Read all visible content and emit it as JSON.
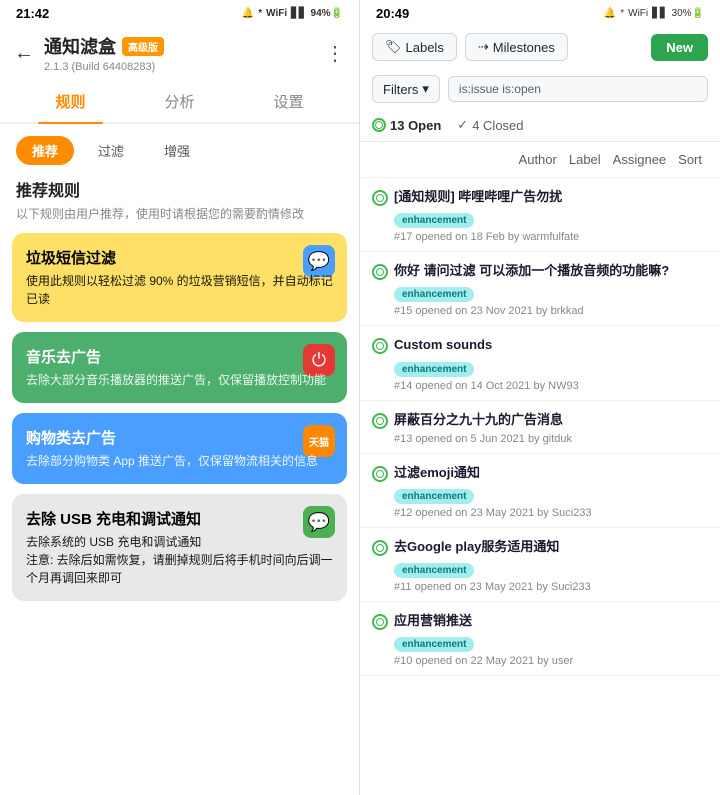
{
  "left": {
    "status_time": "21:42",
    "status_icons": "🔕 * ⑂ 📶 📶 94%",
    "back_label": "←",
    "title": "通知滤盒",
    "badge_pro": "高级版",
    "version": "2.1.3 (Build 64408283)",
    "menu_icon": "⋮",
    "tabs": [
      {
        "label": "规则",
        "active": true
      },
      {
        "label": "分析",
        "active": false
      },
      {
        "label": "设置",
        "active": false
      }
    ],
    "sub_tabs": [
      {
        "label": "推荐",
        "active": true
      },
      {
        "label": "过滤",
        "active": false
      },
      {
        "label": "增强",
        "active": false
      }
    ],
    "section_title": "推荐规则",
    "section_desc": "以下规则由用户推荐，使用时请根据您的需要酌情修改",
    "cards": [
      {
        "title": "垃圾短信过滤",
        "desc": "使用此规则以轻松过滤 90% 的垃圾营销短信，并自动标记已读",
        "color": "yellow",
        "icon": "💬",
        "icon_style": "blue-icon"
      },
      {
        "title": "音乐去广告",
        "desc": "去除大部分音乐播放器的推送广告，仅保留播放控制功能",
        "color": "green",
        "icon": "⏻",
        "icon_style": "red-icon"
      },
      {
        "title": "购物类去广告",
        "desc": "去除部分购物类 App 推送广告，仅保留物流相关的信息",
        "color": "blue",
        "icon": "天猫",
        "icon_style": "orange-icon"
      },
      {
        "title": "去除 USB 充电和调试通知",
        "desc": "去除系统的 USB 充电和调试通知\n注意: 去除后如需恢复，请删掉规则后将手机时间向后调一个月再调回来即可",
        "color": "gray",
        "icon": "💬",
        "icon_style": "green-msg"
      }
    ]
  },
  "right": {
    "status_time": "20:49",
    "status_icons": "🔕 * ⑂ 📶 📶 30%",
    "buttons": {
      "labels_label": "Labels",
      "milestones_label": "Milestones",
      "new_label": "New"
    },
    "filter": {
      "filter_label": "Filters",
      "filter_chevron": "▾",
      "search_value": "is:issue is:open"
    },
    "open_count": "13 Open",
    "closed_count": "4 Closed",
    "check_icon": "✓",
    "cols": {
      "author": "Author",
      "label": "Label",
      "assignee": "Assignee",
      "sort": "Sort"
    },
    "issues": [
      {
        "title": "[通知规则] 哔哩哔哩广告勿扰",
        "badge": "enhancement",
        "meta": "#17 opened on 18 Feb by warmfulfate"
      },
      {
        "title": "你好 请问过滤 可以添加一个播放音频的功能嘛?",
        "badge": "enhancement",
        "meta": "#15 opened on 23 Nov 2021 by brkkad"
      },
      {
        "title": "Custom sounds",
        "badge": "enhancement",
        "meta": "#14 opened on 14 Oct 2021 by NW93"
      },
      {
        "title": "屏蔽百分之九十九的广告消息",
        "badge": null,
        "meta": "#13 opened on 5 Jun 2021 by gitduk"
      },
      {
        "title": "过滤emoji通知",
        "badge": "enhancement",
        "meta": "#12 opened on 23 May 2021 by Suci233"
      },
      {
        "title": "去Google play服务适用通知",
        "badge": "enhancement",
        "meta": "#11 opened on 23 May 2021 by Suci233"
      },
      {
        "title": "应用营销推送",
        "badge": "enhancement",
        "meta": "#10 opened on 22 May 2021 by user"
      }
    ]
  }
}
